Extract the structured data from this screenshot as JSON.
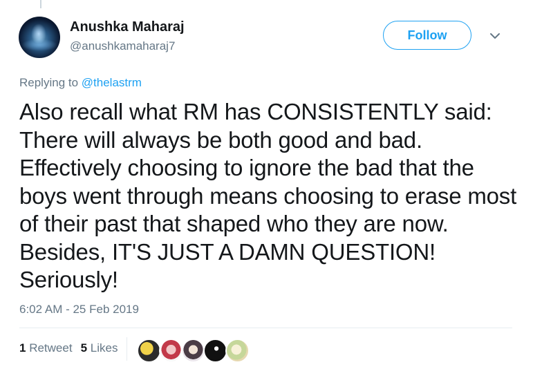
{
  "user": {
    "display_name": "Anushka Maharaj",
    "screen_name": "@anushkamaharaj7",
    "avatar_icon": "profile-avatar"
  },
  "follow_button": {
    "label": "Follow",
    "color": "#1da1f2"
  },
  "menu": {
    "icon": "chevron-down-icon"
  },
  "reply": {
    "prefix": "Replying to",
    "mention": "@thelastrm"
  },
  "tweet": {
    "text": "Also recall what RM has CONSISTENTLY said: There will always be both good and bad. Effectively choosing to ignore the bad that the boys went through means choosing to erase most of their past that shaped who they are now. Besides, IT'S JUST A DAMN QUESTION! Seriously!",
    "timestamp": "6:02 AM - 25 Feb 2019"
  },
  "stats": {
    "retweet_count": "1",
    "retweet_label": "Retweet",
    "like_count": "5",
    "like_label": "Likes"
  },
  "likers": [
    "liker-avatar-1",
    "liker-avatar-2",
    "liker-avatar-3",
    "liker-avatar-4",
    "liker-avatar-5"
  ],
  "colors": {
    "accent": "#1da1f2",
    "secondary_text": "#657786",
    "primary_text": "#14171a",
    "divider": "#e6ecf0"
  }
}
